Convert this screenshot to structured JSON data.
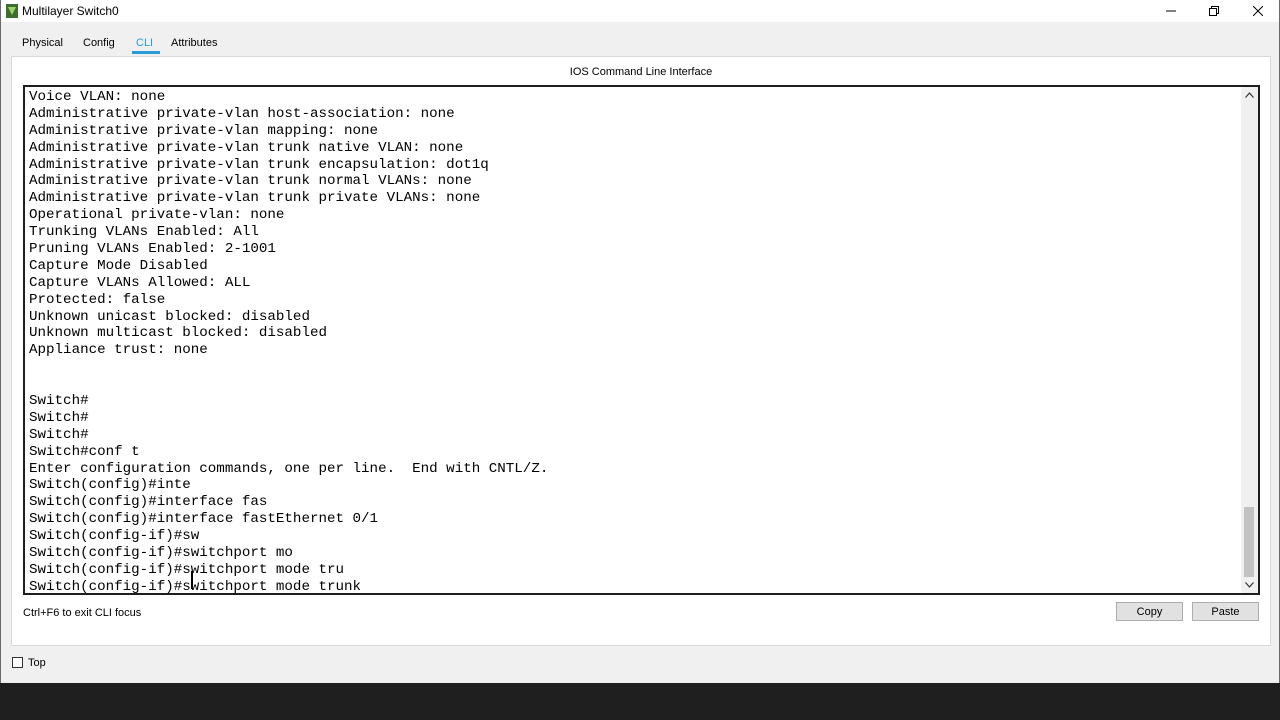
{
  "window": {
    "title": "Multilayer Switch0"
  },
  "tabs": [
    {
      "label": "Physical"
    },
    {
      "label": "Config"
    },
    {
      "label": "CLI"
    },
    {
      "label": "Attributes"
    }
  ],
  "active_tab": "CLI",
  "panel": {
    "title": "IOS Command Line Interface"
  },
  "terminal": {
    "lines": [
      "Voice VLAN: none",
      "Administrative private-vlan host-association: none",
      "Administrative private-vlan mapping: none",
      "Administrative private-vlan trunk native VLAN: none",
      "Administrative private-vlan trunk encapsulation: dot1q",
      "Administrative private-vlan trunk normal VLANs: none",
      "Administrative private-vlan trunk private VLANs: none",
      "Operational private-vlan: none",
      "Trunking VLANs Enabled: All",
      "Pruning VLANs Enabled: 2-1001",
      "Capture Mode Disabled",
      "Capture VLANs Allowed: ALL",
      "Protected: false",
      "Unknown unicast blocked: disabled",
      "Unknown multicast blocked: disabled",
      "Appliance trust: none",
      "",
      "",
      "Switch#",
      "Switch#",
      "Switch#",
      "Switch#conf t",
      "Enter configuration commands, one per line.  End with CNTL/Z.",
      "Switch(config)#inte",
      "Switch(config)#interface fas",
      "Switch(config)#interface fastEthernet 0/1",
      "Switch(config-if)#sw",
      "Switch(config-if)#switchport mo",
      "Switch(config-if)#switchport mode tru",
      "Switch(config-if)#switchport mode trunk"
    ]
  },
  "footer": {
    "hint": "Ctrl+F6 to exit CLI focus",
    "copy_label": "Copy",
    "paste_label": "Paste"
  },
  "bottom": {
    "top_label": "Top",
    "top_checked": false
  },
  "colors": {
    "accent": "#2a9bd6",
    "taskbar": "#1f1f1f"
  }
}
